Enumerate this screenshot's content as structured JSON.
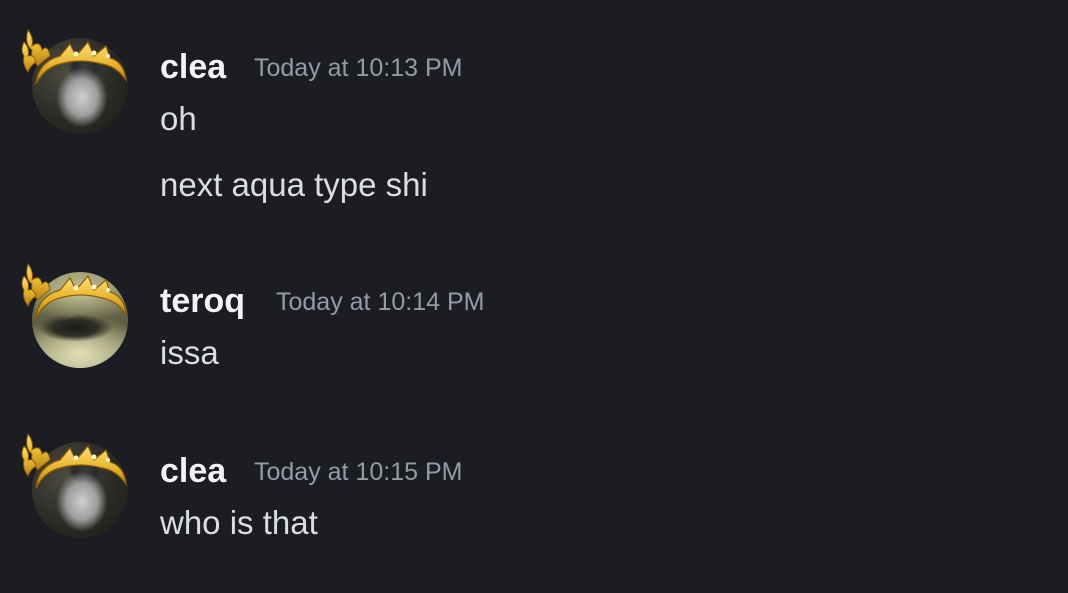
{
  "messages": [
    {
      "author": "clea",
      "timestamp": "Today at 10:13 PM",
      "avatar_icon": "crowned-avatar-icon",
      "lines": [
        "oh",
        "next aqua type shi"
      ]
    },
    {
      "author": "teroq",
      "timestamp": "Today at 10:14 PM",
      "avatar_icon": "crowned-avatar-icon",
      "lines": [
        "issa"
      ]
    },
    {
      "author": "clea",
      "timestamp": "Today at 10:15 PM",
      "avatar_icon": "crowned-avatar-icon",
      "lines": [
        "who is that"
      ]
    }
  ],
  "colors": {
    "background": "#1c1d22",
    "author": "#f2f3f5",
    "timestamp": "#949ba4",
    "message_text": "#dbdee1",
    "crown_gold": "#e8b630"
  }
}
